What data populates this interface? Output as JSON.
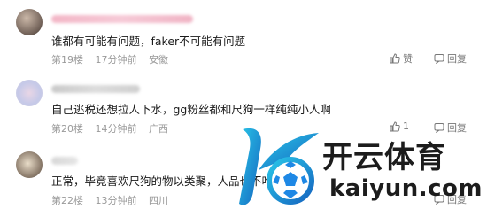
{
  "comments": [
    {
      "text": "谁都有可能有问题，faker不可能有问题",
      "floor": "第19楼",
      "time": "17分钟前",
      "location": "安徽",
      "like_label": "赞",
      "reply_label": "回复"
    },
    {
      "text": "自己逃税还想拉人下水，gg粉丝都和尺狗一样纯纯小人啊",
      "floor": "第20楼",
      "time": "14分钟前",
      "location": "广西",
      "like_count": "1",
      "reply_label": "回复"
    },
    {
      "text": "正常，毕竟喜欢尺狗的物以类聚，人品也不咋地",
      "floor": "第22楼",
      "time": "13分钟前",
      "location": "四川",
      "reply_label": "回复"
    }
  ],
  "watermark": {
    "brand_cn": "开云体育",
    "brand_en": "kaiyun.com",
    "colors": {
      "blue": "#1e88e5",
      "cyan": "#29c6e8",
      "dark": "#1c1c1c"
    }
  }
}
